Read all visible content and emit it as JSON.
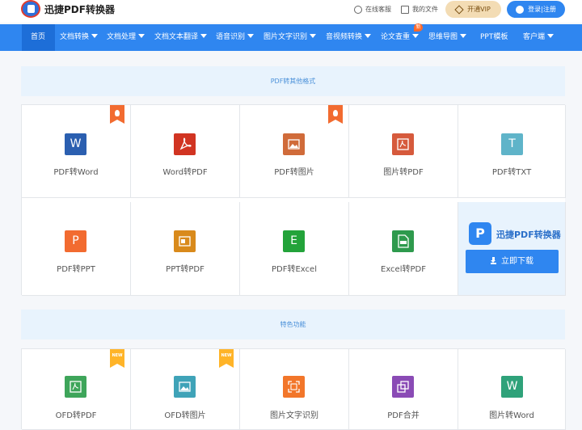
{
  "header": {
    "brand": "迅捷PDF转换器",
    "online_service": "在线客服",
    "my_files": "我的文件",
    "vip": "开通VIP",
    "login": "登录|注册"
  },
  "nav": {
    "items": [
      {
        "label": "首页",
        "dropdown": false,
        "active": true
      },
      {
        "label": "文档转换",
        "dropdown": true
      },
      {
        "label": "文档处理",
        "dropdown": true
      },
      {
        "label": "文档文本翻译",
        "dropdown": true
      },
      {
        "label": "语音识别",
        "dropdown": true
      },
      {
        "label": "图片文字识别",
        "dropdown": true
      },
      {
        "label": "音视频转换",
        "dropdown": true
      },
      {
        "label": "论文查重",
        "dropdown": true
      },
      {
        "label": "思维导图",
        "dropdown": true
      },
      {
        "label": "PPT模板",
        "dropdown": false
      },
      {
        "label": "客户端",
        "dropdown": true
      }
    ],
    "new_tag": "新"
  },
  "section1": {
    "title": "PDF转其他格式",
    "tools": [
      {
        "label": "PDF转Word",
        "glyph": "W",
        "color": "#2b5fb0",
        "badge": "hot"
      },
      {
        "label": "Word转PDF",
        "glyph": "pdf",
        "color": "#d13422",
        "badge": ""
      },
      {
        "label": "PDF转图片",
        "glyph": "img",
        "color": "#d06b3a",
        "badge": "hot"
      },
      {
        "label": "图片转PDF",
        "glyph": "pdf",
        "color": "#d65a3c",
        "badge": ""
      },
      {
        "label": "PDF转TXT",
        "glyph": "T",
        "color": "#5fb4c9",
        "badge": ""
      },
      {
        "label": "PDF转PPT",
        "glyph": "P",
        "color": "#f26b30",
        "badge": ""
      },
      {
        "label": "PPT转PDF",
        "glyph": "ppt",
        "color": "#d98a1b",
        "badge": ""
      },
      {
        "label": "PDF转Excel",
        "glyph": "E",
        "color": "#23a33a",
        "badge": ""
      },
      {
        "label": "Excel转PDF",
        "glyph": "pdf2",
        "color": "#2e9a4d",
        "badge": ""
      }
    ],
    "promo": {
      "logo_glyph": "P",
      "name": "迅捷PDF转换器",
      "download": "立即下载"
    }
  },
  "section2": {
    "title": "特色功能",
    "tools": [
      {
        "label": "OFD转PDF",
        "glyph": "pdf",
        "color": "#3ea55a",
        "badge": "new"
      },
      {
        "label": "OFD转图片",
        "glyph": "img",
        "color": "#3fa3b8",
        "badge": "new"
      },
      {
        "label": "图片文字识别",
        "glyph": "ocr",
        "color": "#f2762a",
        "badge": ""
      },
      {
        "label": "PDF合并",
        "glyph": "merge",
        "color": "#8a4bb5",
        "badge": ""
      },
      {
        "label": "图片转Word",
        "glyph": "W",
        "color": "#2fa27a",
        "badge": ""
      }
    ],
    "new_badge": "NEW"
  }
}
